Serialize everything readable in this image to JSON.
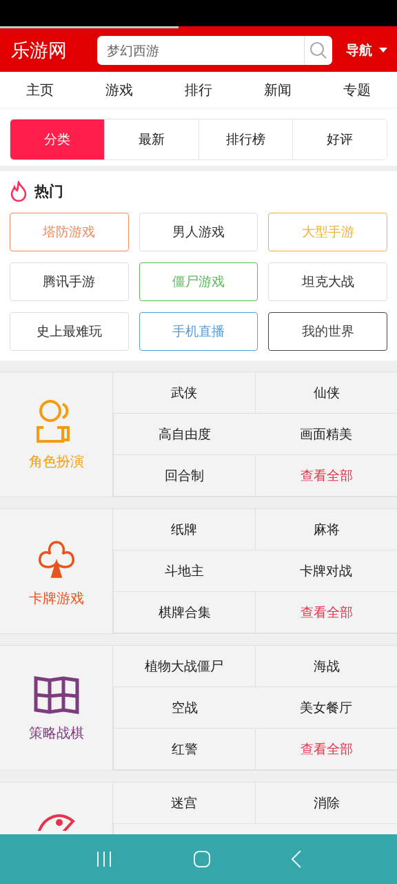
{
  "load_progress": {
    "level": 0.45
  },
  "header": {
    "logo": "乐游网",
    "search": {
      "placeholder": "梦幻西游"
    },
    "nav_menu": "导航"
  },
  "nav": [
    "主页",
    "游戏",
    "排行",
    "新闻",
    "专题"
  ],
  "tabs": [
    {
      "label": "分类",
      "selected": true
    },
    {
      "label": "最新",
      "selected": false
    },
    {
      "label": "排行榜",
      "selected": false
    },
    {
      "label": "好评",
      "selected": false
    }
  ],
  "hot": {
    "title": "热门",
    "tags": [
      {
        "label": "塔防游戏",
        "color": "#ef8a62"
      },
      {
        "label": "男人游戏",
        "color": "#dddddd"
      },
      {
        "label": "大型手游",
        "color": "#f2b233"
      },
      {
        "label": "腾讯手游",
        "color": "#dddddd"
      },
      {
        "label": "僵尸游戏",
        "color": "#5cb85c"
      },
      {
        "label": "坦克大战",
        "color": "#dddddd"
      },
      {
        "label": "史上最难玩",
        "color": "#dddddd"
      },
      {
        "label": "手机直播",
        "color": "#5b9bd5"
      },
      {
        "label": "我的世界",
        "color": "#444444"
      }
    ]
  },
  "categories": [
    {
      "name": "角色扮演",
      "kind": "people",
      "color": "#f39c12",
      "cells": [
        {
          "label": "武侠",
          "kind": "tag"
        },
        {
          "label": "仙侠",
          "kind": "tag"
        },
        {
          "label": "高自由度",
          "kind": "tag"
        },
        {
          "label": "画面精美",
          "kind": "tag"
        },
        {
          "label": "回合制",
          "kind": "tag"
        },
        {
          "label": "查看全部",
          "kind": "more"
        }
      ]
    },
    {
      "name": "卡牌游戏",
      "kind": "club",
      "color": "#e8541e",
      "cells": [
        {
          "label": "纸牌",
          "kind": "tag"
        },
        {
          "label": "麻将",
          "kind": "tag"
        },
        {
          "label": "斗地主",
          "kind": "tag"
        },
        {
          "label": "卡牌对战",
          "kind": "tag"
        },
        {
          "label": "棋牌合集",
          "kind": "tag"
        },
        {
          "label": "查看全部",
          "kind": "more"
        }
      ]
    },
    {
      "name": "策略战棋",
      "kind": "map",
      "color": "#7d3c7d",
      "cells": [
        {
          "label": "植物大战僵尸",
          "kind": "tag"
        },
        {
          "label": "海战",
          "kind": "tag"
        },
        {
          "label": "空战",
          "kind": "tag"
        },
        {
          "label": "美女餐厅",
          "kind": "tag"
        },
        {
          "label": "红警",
          "kind": "tag"
        },
        {
          "label": "查看全部",
          "kind": "more"
        }
      ]
    },
    {
      "kind": "fish",
      "color": "#e8334a",
      "cells": [
        {
          "label": "迷宫",
          "kind": "tag"
        },
        {
          "label": "消除",
          "kind": "tag"
        }
      ]
    }
  ]
}
